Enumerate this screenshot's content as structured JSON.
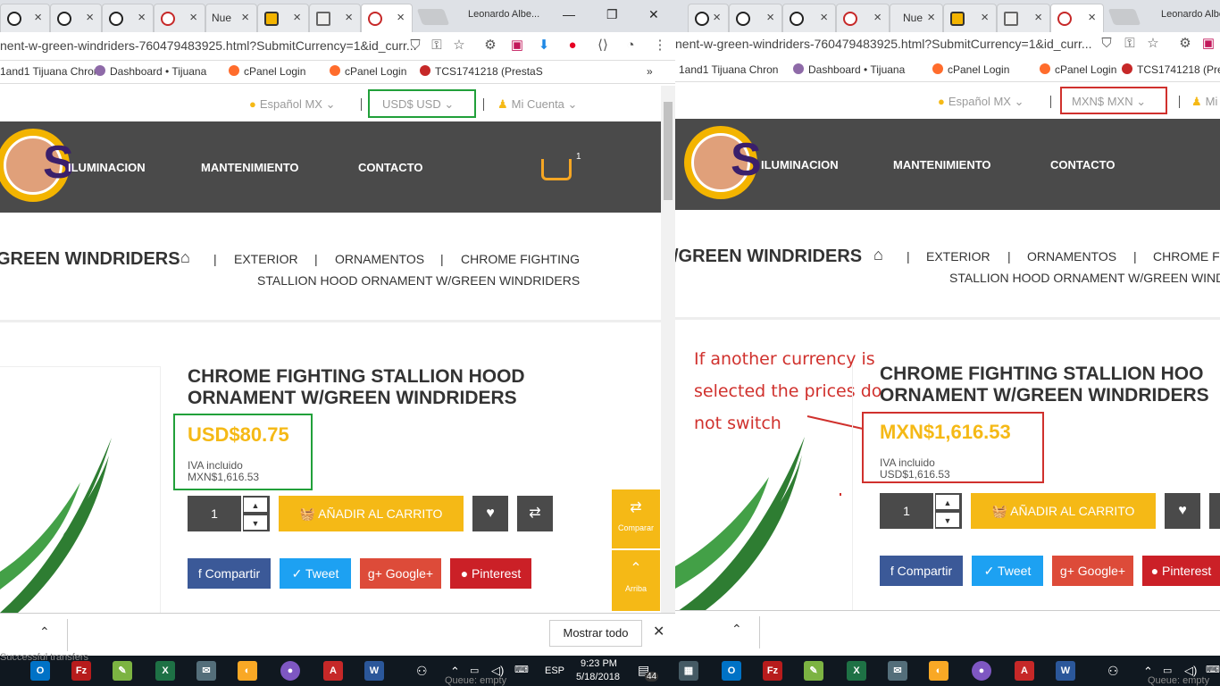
{
  "browser": {
    "tab_short": "Nue",
    "profile_name": "Leonardo Albe...",
    "url": "nent-w-green-windriders-760479483925.html?SubmitCurrency=1&id_curr...",
    "bookmarks": [
      "1and1 Tijuana Chron",
      "Dashboard • Tijuana",
      "cPanel Login",
      "cPanel Login",
      "TCS1741218 (PrestaS"
    ],
    "more_bookmarks": "»"
  },
  "store": {
    "language": "Español MX",
    "currency_left": "USD$ USD",
    "currency_right": "MXN$ MXN",
    "account": "Mi Cuenta",
    "account_short": "Mi",
    "nav": [
      "ILUMINACION",
      "MANTENIMIENTO",
      "CONTACTO"
    ],
    "cart_count": "1",
    "breadcrumb": {
      "current_left": "GREEN WINDRIDERS",
      "current_right": "/GREEN WINDRIDERS",
      "items": [
        "EXTERIOR",
        "ORNAMENTOS"
      ],
      "last_left": "CHROME FIGHTING",
      "last_right": "CHROME F",
      "last_line2_left": "STALLION HOOD ORNAMENT W/GREEN WINDRIDERS",
      "last_line2_right": "STALLION HOOD ORNAMENT W/GREEN WIND",
      "separator": "|"
    },
    "product": {
      "title_line1": "CHROME FIGHTING STALLION HOOD",
      "title_line1_right": "CHROME FIGHTING STALLION HOO",
      "title_line2": "ORNAMENT W/GREEN WINDRIDERS",
      "title_line2_right": "ORNAMENT W/GREEN WINDRIDERS",
      "price_left": "USD$80.75",
      "price_right": "MXN$1,616.53",
      "tax_label": "IVA incluido",
      "alt_price_left": "MXN$1,616.53",
      "alt_price_right": "USD$1,616.53",
      "qty": "1",
      "add_to_cart": "AÑADIR AL CARRITO",
      "share": [
        "Compartir",
        "Tweet",
        "Google+",
        "Pinterest"
      ]
    },
    "side_buttons": [
      "Comparar",
      "Arriba"
    ]
  },
  "annotation": {
    "lines": [
      "If another currency is",
      "selected the prices do",
      "not switch"
    ],
    "colors": {
      "green_box": "#21a03a",
      "red_box": "#d0312d"
    }
  },
  "downloads": {
    "show_all": "Mostrar todo",
    "ghost_text": "Successful transfers"
  },
  "taskbar": {
    "language": "ESP",
    "time": "9:23 PM",
    "date": "5/18/2018",
    "notif_count": "44",
    "queue_text": "Queue: empty"
  }
}
